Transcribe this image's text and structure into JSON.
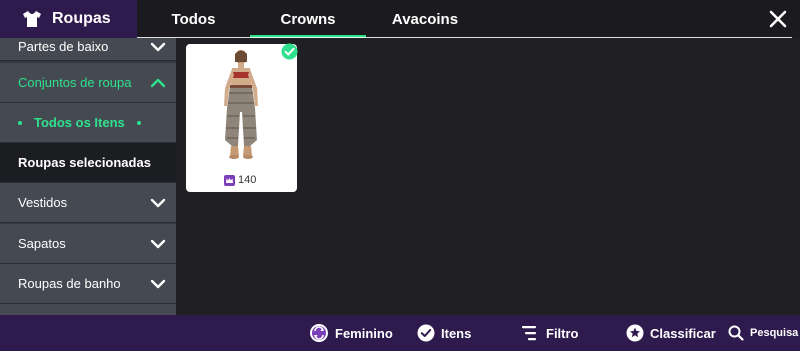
{
  "header": {
    "title": "Roupas",
    "tabs": [
      {
        "label": "Todos",
        "active": false
      },
      {
        "label": "Crowns",
        "active": true
      },
      {
        "label": "Avacoins",
        "active": false
      }
    ]
  },
  "sidebar": {
    "items": [
      {
        "label": "Partes de baixo",
        "state": "collapsed"
      },
      {
        "label": "Conjuntos de roupa",
        "state": "expanded"
      },
      {
        "label": "Todos os Itens",
        "state": "active-subitem"
      },
      {
        "label": "Roupas selecionadas",
        "state": "selected"
      },
      {
        "label": "Vestidos",
        "state": "collapsed"
      },
      {
        "label": "Sapatos",
        "state": "collapsed"
      },
      {
        "label": "Roupas de banho",
        "state": "collapsed"
      }
    ]
  },
  "items": [
    {
      "price": "140",
      "currency": "crown",
      "selected": true
    }
  ],
  "bottombar": {
    "gender_label": "Feminino",
    "items_label": "Itens",
    "filter_label": "Filtro",
    "sort_label": "Classificar",
    "search_label": "Pesquisa"
  },
  "colors": {
    "accent": "#2fe08c",
    "brand_purple": "#2e1a4d",
    "crown_purple": "#7a3fb8",
    "sidebar": "#343840",
    "background": "#1f1f24"
  }
}
